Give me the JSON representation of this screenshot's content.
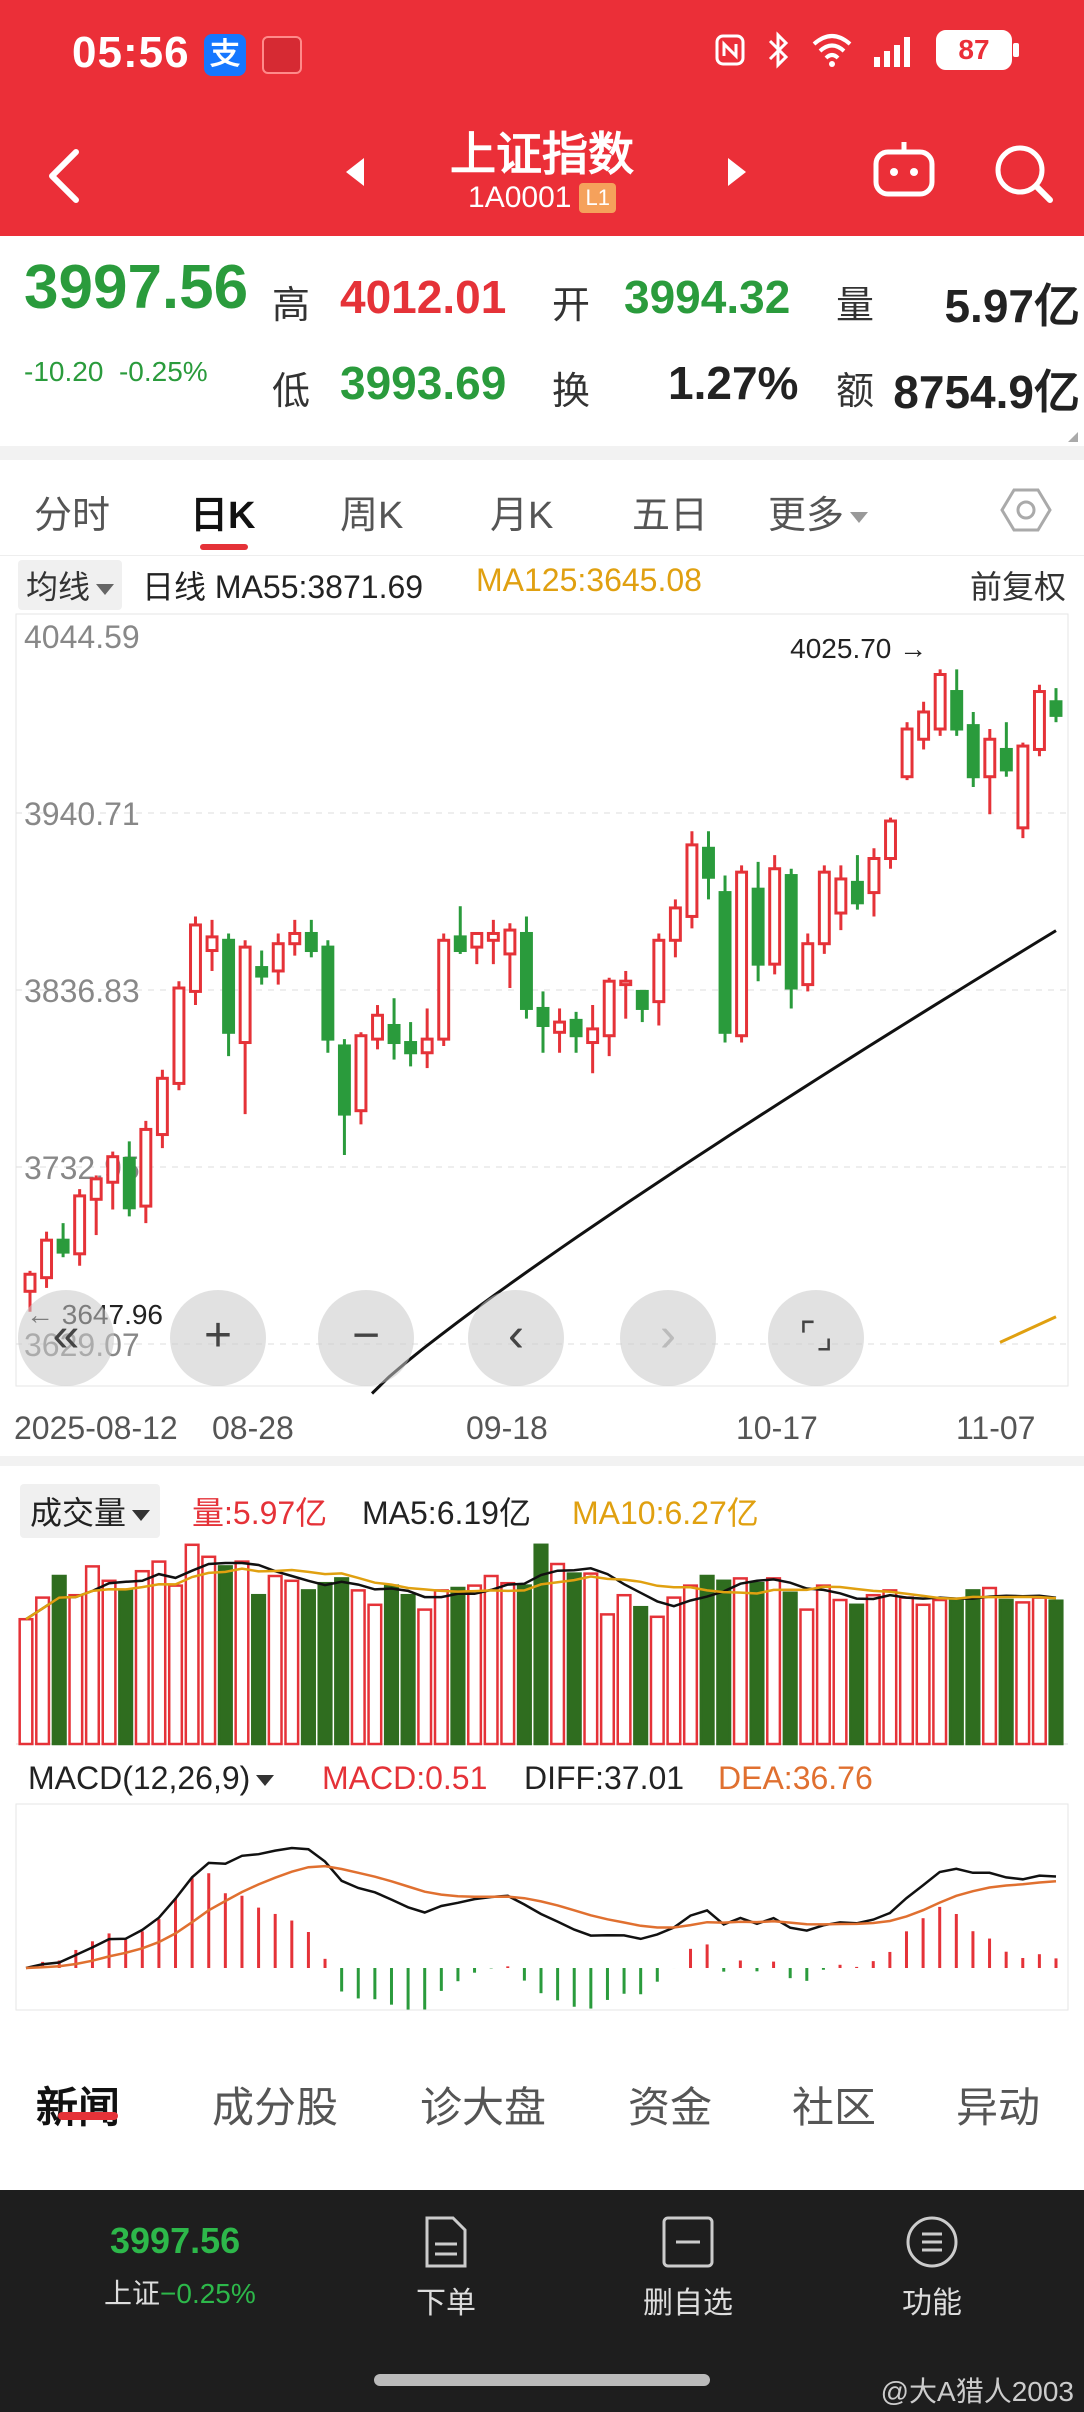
{
  "status_bar": {
    "time": "05:56",
    "alipay_glyph": "支",
    "battery": "87"
  },
  "header": {
    "title": "上证指数",
    "code": "1A0001",
    "level_badge": "L1",
    "accent": "#eb2f38"
  },
  "quote": {
    "price": "3997.56",
    "change": "-10.20",
    "change_pct": "-0.25%",
    "high_label": "高",
    "high": "4012.01",
    "open_label": "开",
    "open": "3994.32",
    "volume_label": "量",
    "volume": "5.97亿",
    "low_label": "低",
    "low": "3993.69",
    "turnover_label": "换",
    "turnover": "1.27%",
    "amount_label": "额",
    "amount": "8754.9亿"
  },
  "period_tabs": [
    "分时",
    "日K",
    "周K",
    "月K",
    "五日",
    "更多"
  ],
  "active_period": "日K",
  "indicator_bar": {
    "selector": "均线",
    "ma55": "日线 MA55:3871.69",
    "ma125": "MA125:3645.08",
    "adjust": "前复权"
  },
  "chart_data": {
    "type": "candlestick",
    "y_ticks": [
      "4044.59",
      "3940.71",
      "3836.83",
      "3732.95",
      "3629.07"
    ],
    "max_label": "4025.70",
    "min_label": "3647.96",
    "x_ticks": [
      "2025-08-12",
      "08-28",
      "09-18",
      "10-17",
      "11-07"
    ],
    "candles": [
      {
        "o": 3660,
        "h": 3672,
        "l": 3648,
        "c": 3670
      },
      {
        "o": 3668,
        "h": 3695,
        "l": 3662,
        "c": 3690
      },
      {
        "o": 3690,
        "h": 3700,
        "l": 3680,
        "c": 3683
      },
      {
        "o": 3682,
        "h": 3720,
        "l": 3675,
        "c": 3716
      },
      {
        "o": 3714,
        "h": 3728,
        "l": 3693,
        "c": 3726
      },
      {
        "o": 3724,
        "h": 3742,
        "l": 3708,
        "c": 3739
      },
      {
        "o": 3738,
        "h": 3748,
        "l": 3704,
        "c": 3709
      },
      {
        "o": 3710,
        "h": 3760,
        "l": 3700,
        "c": 3755
      },
      {
        "o": 3752,
        "h": 3790,
        "l": 3744,
        "c": 3785
      },
      {
        "o": 3782,
        "h": 3842,
        "l": 3778,
        "c": 3838
      },
      {
        "o": 3836,
        "h": 3880,
        "l": 3828,
        "c": 3875
      },
      {
        "o": 3860,
        "h": 3878,
        "l": 3848,
        "c": 3868
      },
      {
        "o": 3866,
        "h": 3870,
        "l": 3798,
        "c": 3812
      },
      {
        "o": 3806,
        "h": 3866,
        "l": 3764,
        "c": 3862
      },
      {
        "o": 3850,
        "h": 3860,
        "l": 3840,
        "c": 3845
      },
      {
        "o": 3848,
        "h": 3870,
        "l": 3840,
        "c": 3864
      },
      {
        "o": 3864,
        "h": 3878,
        "l": 3857,
        "c": 3870
      },
      {
        "o": 3870,
        "h": 3878,
        "l": 3856,
        "c": 3860
      },
      {
        "o": 3862,
        "h": 3866,
        "l": 3800,
        "c": 3808
      },
      {
        "o": 3804,
        "h": 3808,
        "l": 3740,
        "c": 3764
      },
      {
        "o": 3766,
        "h": 3812,
        "l": 3758,
        "c": 3810
      },
      {
        "o": 3808,
        "h": 3828,
        "l": 3802,
        "c": 3822
      },
      {
        "o": 3816,
        "h": 3832,
        "l": 3796,
        "c": 3806
      },
      {
        "o": 3806,
        "h": 3818,
        "l": 3792,
        "c": 3800
      },
      {
        "o": 3800,
        "h": 3826,
        "l": 3791,
        "c": 3808
      },
      {
        "o": 3808,
        "h": 3870,
        "l": 3804,
        "c": 3866
      },
      {
        "o": 3868,
        "h": 3886,
        "l": 3858,
        "c": 3860
      },
      {
        "o": 3862,
        "h": 3870,
        "l": 3852,
        "c": 3870
      },
      {
        "o": 3866,
        "h": 3878,
        "l": 3852,
        "c": 3870
      },
      {
        "o": 3858,
        "h": 3876,
        "l": 3838,
        "c": 3872
      },
      {
        "o": 3870,
        "h": 3880,
        "l": 3820,
        "c": 3826
      },
      {
        "o": 3826,
        "h": 3836,
        "l": 3800,
        "c": 3816
      },
      {
        "o": 3812,
        "h": 3826,
        "l": 3800,
        "c": 3818
      },
      {
        "o": 3819,
        "h": 3824,
        "l": 3800,
        "c": 3810
      },
      {
        "o": 3806,
        "h": 3828,
        "l": 3788,
        "c": 3814
      },
      {
        "o": 3810,
        "h": 3844,
        "l": 3798,
        "c": 3842
      },
      {
        "o": 3840,
        "h": 3848,
        "l": 3820,
        "c": 3842
      },
      {
        "o": 3836,
        "h": 3836,
        "l": 3818,
        "c": 3826
      },
      {
        "o": 3830,
        "h": 3870,
        "l": 3816,
        "c": 3866
      },
      {
        "o": 3866,
        "h": 3890,
        "l": 3856,
        "c": 3885
      },
      {
        "o": 3880,
        "h": 3930,
        "l": 3873,
        "c": 3922
      },
      {
        "o": 3920,
        "h": 3930,
        "l": 3890,
        "c": 3903
      },
      {
        "o": 3894,
        "h": 3904,
        "l": 3806,
        "c": 3812
      },
      {
        "o": 3810,
        "h": 3910,
        "l": 3806,
        "c": 3906
      },
      {
        "o": 3896,
        "h": 3912,
        "l": 3842,
        "c": 3852
      },
      {
        "o": 3852,
        "h": 3916,
        "l": 3846,
        "c": 3908
      },
      {
        "o": 3904,
        "h": 3908,
        "l": 3826,
        "c": 3838
      },
      {
        "o": 3840,
        "h": 3870,
        "l": 3836,
        "c": 3864
      },
      {
        "o": 3864,
        "h": 3910,
        "l": 3858,
        "c": 3906
      },
      {
        "o": 3882,
        "h": 3910,
        "l": 3872,
        "c": 3902
      },
      {
        "o": 3900,
        "h": 3916,
        "l": 3884,
        "c": 3888
      },
      {
        "o": 3894,
        "h": 3920,
        "l": 3880,
        "c": 3914
      },
      {
        "o": 3914,
        "h": 3938,
        "l": 3908,
        "c": 3936
      },
      {
        "o": 3962,
        "h": 3994,
        "l": 3960,
        "c": 3990
      },
      {
        "o": 3984,
        "h": 4006,
        "l": 3978,
        "c": 4000
      },
      {
        "o": 3990,
        "h": 4025,
        "l": 3986,
        "c": 4022
      },
      {
        "o": 4012,
        "h": 4025,
        "l": 3986,
        "c": 3990
      },
      {
        "o": 3992,
        "h": 4000,
        "l": 3956,
        "c": 3962
      },
      {
        "o": 3962,
        "h": 3990,
        "l": 3940,
        "c": 3984
      },
      {
        "o": 3978,
        "h": 3994,
        "l": 3962,
        "c": 3966
      },
      {
        "o": 3932,
        "h": 3982,
        "l": 3926,
        "c": 3980
      },
      {
        "o": 3978,
        "h": 4016,
        "l": 3974,
        "c": 4012
      },
      {
        "o": 4006,
        "h": 4014,
        "l": 3994,
        "c": 3998
      }
    ],
    "ma55_start": 3600,
    "ma55_end": 3871.69,
    "ma125_visible_end": 3645.08,
    "colors": {
      "up": "#e53238",
      "down": "#2a9b3c",
      "ma55": "#111111",
      "ma125": "#e0a010"
    }
  },
  "zoom_controls": [
    "«",
    "+",
    "−",
    "‹",
    "›",
    "⌜⌟"
  ],
  "volume": {
    "selector": "成交量",
    "vol": "量:5.97亿",
    "ma5": "MA5:6.19亿",
    "ma10": "MA10:6.27亿",
    "values": [
      5.2,
      6.1,
      7.0,
      6.2,
      7.4,
      6.8,
      6.4,
      7.2,
      7.6,
      6.6,
      8.3,
      7.8,
      7.4,
      7.6,
      6.2,
      7.0,
      6.8,
      6.4,
      6.7,
      6.9,
      6.4,
      5.8,
      6.6,
      6.2,
      5.6,
      6.4,
      6.5,
      6.6,
      7.0,
      6.7,
      6.6,
      8.3,
      7.5,
      7.1,
      7.1,
      5.4,
      6.2,
      5.7,
      5.3,
      6.1,
      6.6,
      7.0,
      6.8,
      6.9,
      6.7,
      6.9,
      6.3,
      5.6,
      6.6,
      6.0,
      5.8,
      6.2,
      6.4,
      6.1,
      5.8,
      6.0,
      6.0,
      6.4,
      6.5,
      6.0,
      5.9,
      6.1,
      5.97
    ],
    "max": 8.5
  },
  "macd": {
    "selector": "MACD(12,26,9)",
    "macd": "MACD:0.51",
    "diff": "DIFF:37.01",
    "dea": "DEA:36.76"
  },
  "news_tabs": [
    "新闻",
    "成分股",
    "诊大盘",
    "资金",
    "社区",
    "异动"
  ],
  "bottom_bar": {
    "price": "3997.56",
    "index_name": "上证",
    "change_pct": "−0.25%",
    "items": [
      "下单",
      "删自选",
      "功能"
    ]
  },
  "watermark": "@大A猎人2003"
}
